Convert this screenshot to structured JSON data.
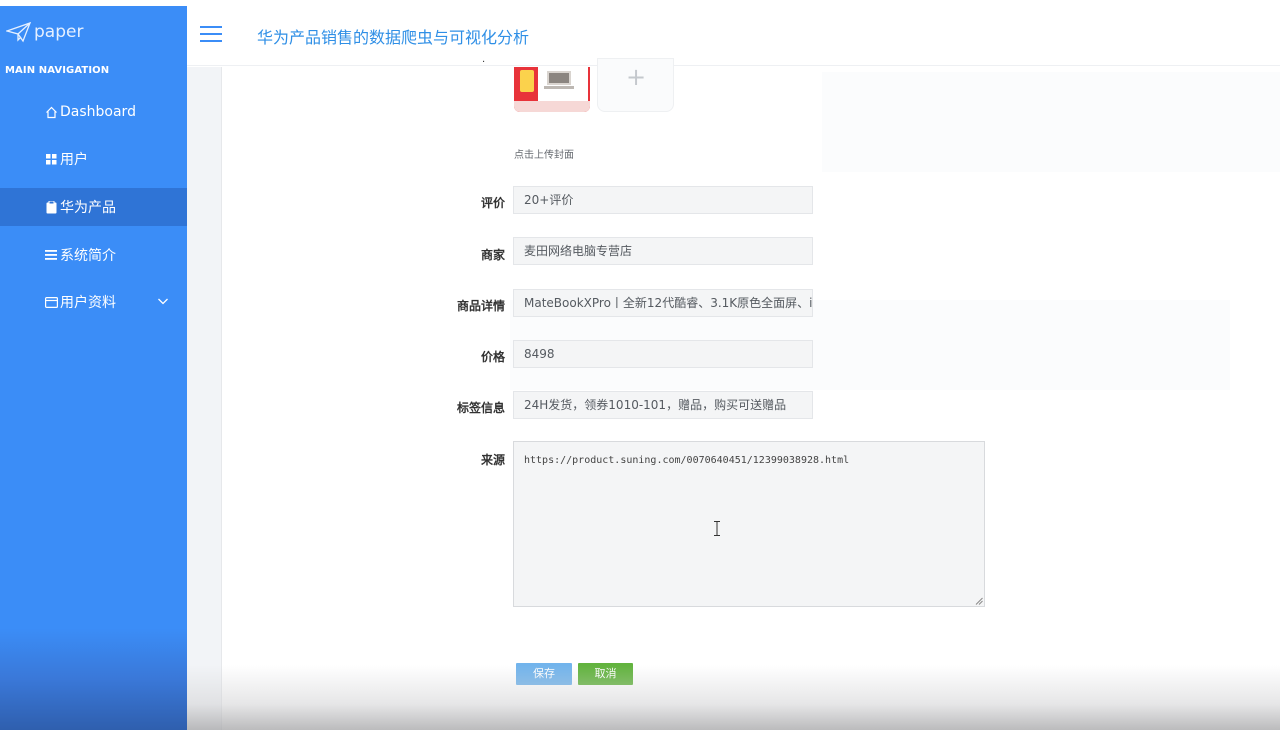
{
  "brand": {
    "logo_text": "paper",
    "logo_icon": "paper-plane-icon"
  },
  "sidebar": {
    "heading": "MAIN NAVIGATION",
    "items": [
      {
        "label": "Dashboard",
        "icon": "home-icon"
      },
      {
        "label": "用户",
        "icon": "grid-icon"
      },
      {
        "label": "华为产品",
        "icon": "clipboard-icon",
        "active": true
      },
      {
        "label": "系统简介",
        "icon": "list-icon"
      },
      {
        "label": "用户资料",
        "icon": "profile-card-icon",
        "expandable": true
      }
    ]
  },
  "header": {
    "title": "华为产品销售的数据爬虫与可视化分析",
    "menu_icon": "hamburger-icon"
  },
  "form": {
    "cover_upload_hint": "点击上传封面",
    "fields": [
      {
        "label": "评价",
        "value": "20+评价"
      },
      {
        "label": "商家",
        "value": "麦田网络电脑专营店"
      },
      {
        "label": "商品详情",
        "value": "MateBookXPro丨全新12代酷睿、3.1K原色全面屏、i"
      },
      {
        "label": "价格",
        "value": "8498"
      },
      {
        "label": "标签信息",
        "value": "24H发货，领券1010-101，赠品，购买可送赠品"
      }
    ],
    "source": {
      "label": "来源",
      "value": "https://product.suning.com/0070640451/12399038928.html"
    },
    "save_label": "保存",
    "cancel_label": "取消"
  },
  "colors": {
    "sidebar": "#3b8df7",
    "sidebar_active": "#2f74d6",
    "title": "#2f8fe6",
    "save": "#72b4ec",
    "cancel": "#62b33e"
  }
}
